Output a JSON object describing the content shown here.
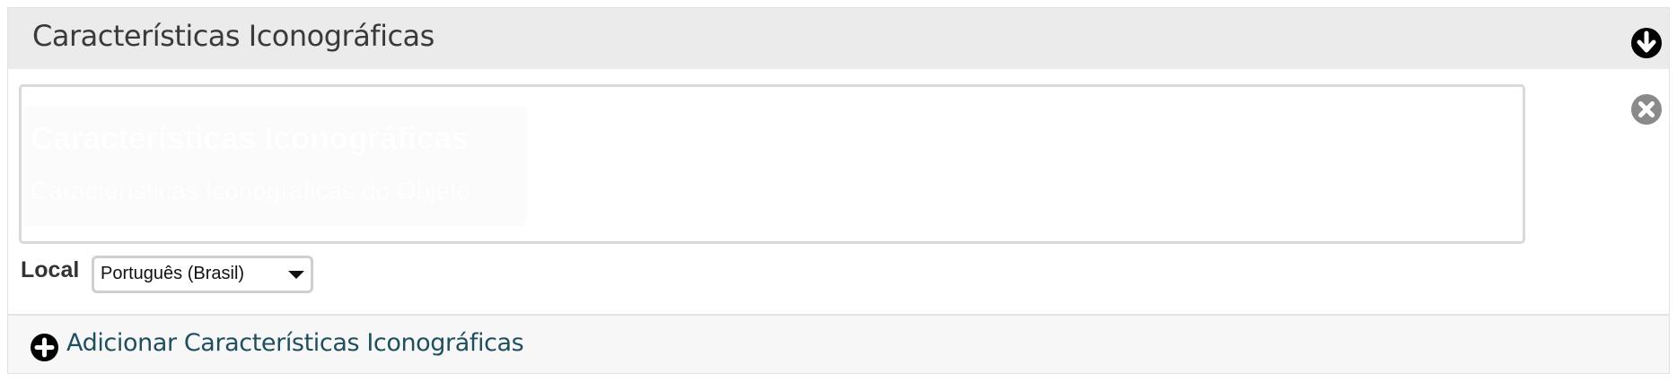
{
  "section": {
    "title": "Características Iconográficas",
    "collapse_icon": "arrow-down-circle-icon"
  },
  "editor": {
    "ghost_title": "Características Iconográficas",
    "ghost_subtitle": "Características Iconográficas do Objeto",
    "remove_icon": "close-circle-icon"
  },
  "locale": {
    "label": "Local",
    "selected": "Português (Brasil)"
  },
  "footer": {
    "add_label": "Adicionar Características Iconográficas",
    "add_icon": "plus-circle-icon"
  },
  "colors": {
    "header_bg": "#ebebeb",
    "panel_bg": "#f7f7f7",
    "link": "#1f4e5f",
    "remove_icon": "#8a8a8a"
  }
}
